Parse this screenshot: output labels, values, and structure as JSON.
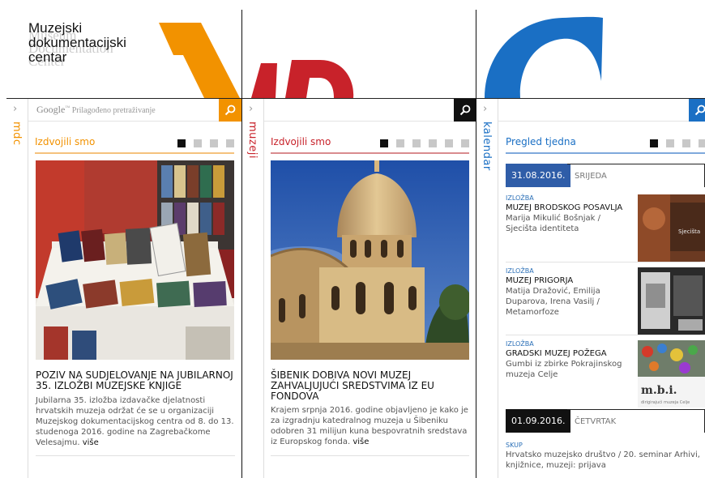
{
  "header": {
    "logo_line1": "Muzejski",
    "logo_line2": "dokumentacijski",
    "logo_line3": "centar",
    "logo_en_line1": "Museum",
    "logo_en_line2": "Documentation",
    "logo_en_line3": "Center"
  },
  "colors": {
    "mdc": "#f29200",
    "muzeji": "#c8222a",
    "kalendar": "#1a6fc4",
    "active_date": "#2f5da8",
    "dark": "#111111"
  },
  "mdc": {
    "tab_label": "mdc",
    "search_google": "Google",
    "search_placeholder": "Prilagođeno pretraživanje",
    "section_title": "Izdvojili smo",
    "feature_title": "POZIV NA SUDJELOVANJE NA JUBILARNOJ 35.  IZLOŽBI MUZEJSKE KNJIGE",
    "feature_body": "Jubilarna 35. izložba izdavačke djelatnosti hrvatskih muzeja održat će se u organizaciji Muzejskog dokumentacijskog centra od 8. do 13. studenoga 2016. godine na Zagrebačkome Velesajmu.",
    "more": "više"
  },
  "muzeji": {
    "tab_label": "muzeji",
    "section_title": "Izdvojili smo",
    "feature_title": "ŠIBENIK DOBIVA NOVI MUZEJ ZAHVALJUJUĆI SREDSTVIMA IZ EU FONDOVA",
    "feature_body": "Krajem srpnja 2016. godine objavljeno je kako je za izgradnju katedralnog muzeja u Šibeniku odobren 31 milijun kuna bespovratnih sredstava iz Europskog fonda.",
    "more": "više"
  },
  "kalendar": {
    "tab_label": "kalendar",
    "section_title": "Pregled tjedna",
    "days": [
      {
        "date": "31.08.2016.",
        "name": "SRIJEDA"
      },
      {
        "date": "01.09.2016.",
        "name": "ČETVRTAK"
      }
    ],
    "events": [
      {
        "type": "IZLOŽBA",
        "title": "MUZEJ BRODSKOG POSAVLJA",
        "subtitle": "Marija Mikulić Bošnjak / Sjecišta identiteta",
        "thumb_text": "Sjecišta"
      },
      {
        "type": "IZLOŽBA",
        "title": "MUZEJ PRIGORJA",
        "subtitle": "Matija Dražović, Emilija Duparova, Irena Vasilj / Metamorfoze"
      },
      {
        "type": "IZLOŽBA",
        "title": "GRADSKI MUZEJ POŽEGA",
        "subtitle": "Gumbi iz zbirke Pokrajinskog muzeja Celje",
        "thumb_logo": "m.b.i.",
        "thumb_caption": "dirigirajući muzeja Celje"
      },
      {
        "type": "SKUP",
        "subtitle": "Hrvatsko muzejsko društvo / 20. seminar Arhivi, knjižnice, muzeji: prijava"
      }
    ]
  }
}
